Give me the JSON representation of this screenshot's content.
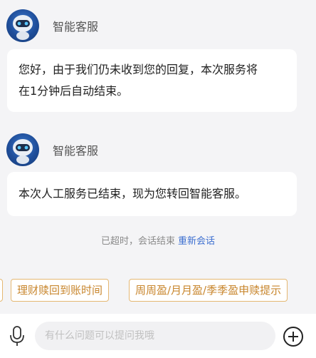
{
  "messages": [
    {
      "sender": "智能客服",
      "text_line1": "您好，由于我们仍未收到您的回复，本次服务将",
      "text_line2": "在1分钟后自动结束。"
    },
    {
      "sender": "智能客服",
      "text_line1": "本次人工服务已结束，现为您转回智能客服。"
    }
  ],
  "system": {
    "text": "已超时，会话结束",
    "link": "重新会话"
  },
  "chips": [
    {
      "label": "理财赎回到账时间"
    },
    {
      "label": "周周盈/月月盈/季季盈申赎提示"
    }
  ],
  "input": {
    "placeholder": "有什么问题可以提问我哦"
  },
  "icons": {
    "voice": "microphone-icon",
    "more": "plus-circle-icon",
    "avatar": "robot-avatar"
  },
  "colors": {
    "accent": "#3d6fd0",
    "chip_text": "#c8862d",
    "chip_border": "#e5b873",
    "background": "#f4f4f6"
  }
}
